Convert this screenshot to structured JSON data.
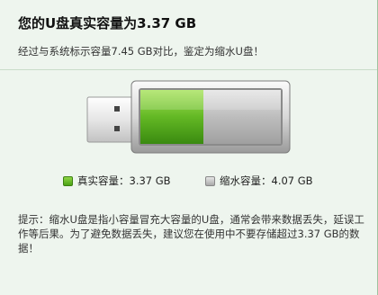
{
  "header": {
    "title": "您的U盘真实容量为3.37 GB",
    "subtitle": "经过与系统标示容量7.45 GB对比，鉴定为缩水U盘！"
  },
  "capacity": {
    "real_fraction": 0.45
  },
  "legend": {
    "real_label": "真实容量：3.37 GB",
    "fake_label": "缩水容量：4.07 GB",
    "real_color": "#5cb51e",
    "fake_color": "#b5b5b5"
  },
  "note": {
    "text": "提示：缩水U盘是指小容量冒充大容量的U盘，通常会带来数据丢失，延误工作等后果。为了避免数据丢失，建议您在使用中不要存储超过3.37 GB的数据！"
  }
}
